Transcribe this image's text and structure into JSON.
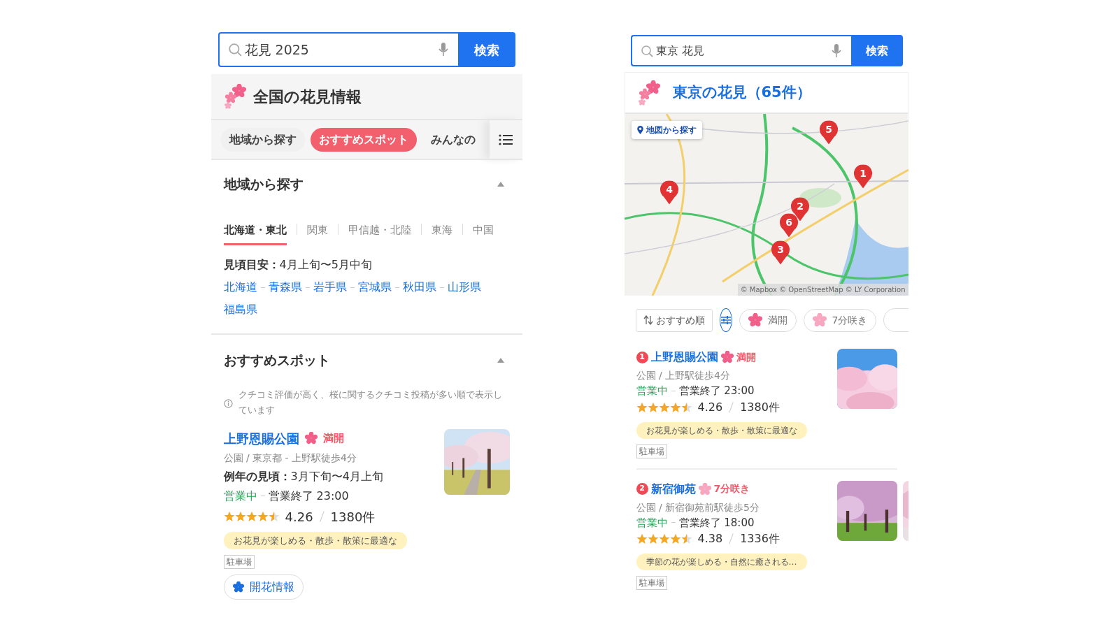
{
  "left": {
    "search": {
      "value": "花見 2025",
      "button": "検索"
    },
    "header": {
      "title": "全国の花見情報"
    },
    "tabs": [
      {
        "label": "地域から探す",
        "selected": false
      },
      {
        "label": "おすすめスポット",
        "selected": true
      },
      {
        "label": "みんなの",
        "selected": false
      }
    ],
    "region_section": {
      "title": "地域から探す",
      "expanded": true,
      "region_tabs": [
        {
          "label": "北海道・東北",
          "selected": true
        },
        {
          "label": "関東",
          "selected": false
        },
        {
          "label": "甲信越・北陸",
          "selected": false
        },
        {
          "label": "東海",
          "selected": false
        },
        {
          "label": "中国",
          "selected": false
        }
      ],
      "season": "**見頃目安：**4月上旬〜5月中旬",
      "prefectures": [
        "北海道",
        "青森県",
        "岩手県",
        "宮城県",
        "秋田県",
        "山形県",
        "福島県"
      ]
    },
    "spot_section": {
      "title": "おすすめスポット",
      "expanded": true,
      "note": "クチコミ評価が高く、桜に関するクチコミ投稿が多い順で表示しています",
      "spots": [
        {
          "name": "上野恩賜公園",
          "bloom": {
            "label": "満開",
            "kind": "full"
          },
          "meta": "公園 / 東京都 - 上野駅徒歩4分",
          "season": "**例年の見頃：**3月下旬〜4月上旬",
          "open_status": "営業中",
          "hours": "営業終了 23:00",
          "stars": 4.5,
          "rating": "4.26",
          "reviews": "1380件",
          "highlight": "お花見が楽しめる・散歩・散策に最適な",
          "tags": [
            "駐車場"
          ],
          "button": "開花情報"
        }
      ]
    }
  },
  "right": {
    "search": {
      "value": "東京 花見",
      "button": "検索"
    },
    "header": {
      "title": "東京の花見（65件）"
    },
    "map": {
      "button": "地図から探す",
      "attribution": "© Mapbox © OpenStreetMap © LY Corporation",
      "pins": [
        {
          "label": "1"
        },
        {
          "label": "2"
        },
        {
          "label": "3"
        },
        {
          "label": "4"
        },
        {
          "label": "5"
        },
        {
          "label": "6"
        }
      ]
    },
    "filters": {
      "sort": "おすすめ順",
      "chips": [
        {
          "label": "満開",
          "kind": "full",
          "selected": false
        },
        {
          "label": "7分咲き",
          "kind": "partial",
          "selected": false
        }
      ]
    },
    "results": [
      {
        "rank": "1",
        "name": "上野恩賜公園",
        "bloom": {
          "label": "満開",
          "kind": "full"
        },
        "meta": "公園 / 上野駅徒歩4分",
        "open_status": "営業中",
        "hours": "営業終了 23:00",
        "stars": 4.5,
        "rating": "4.26",
        "reviews": "1380件",
        "highlight": "お花見が楽しめる・散歩・散策に最適な",
        "tags": [
          "駐車場"
        ]
      },
      {
        "rank": "2",
        "name": "新宿御苑",
        "bloom": {
          "label": "7分咲き",
          "kind": "partial"
        },
        "meta": "公園 / 新宿御苑前駅徒歩5分",
        "open_status": "営業中",
        "hours": "営業終了 18:00",
        "stars": 4.5,
        "rating": "4.38",
        "reviews": "1336件",
        "highlight": "季節の花が楽しめる・自然に癒される…",
        "tags": [
          "駐車場"
        ]
      }
    ]
  }
}
